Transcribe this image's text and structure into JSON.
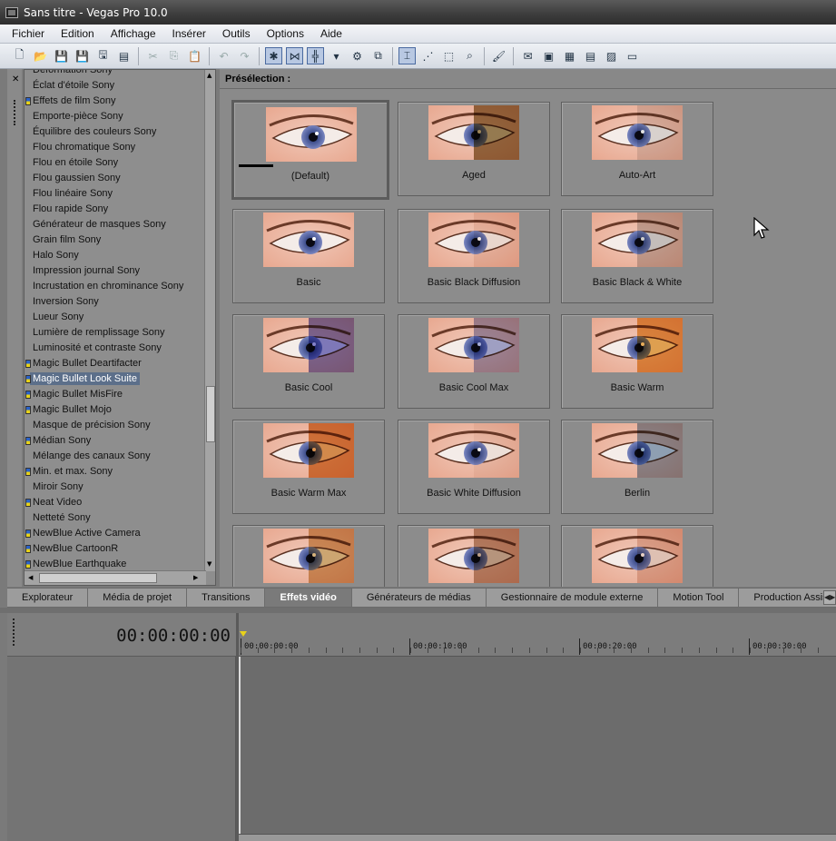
{
  "window": {
    "title": "Sans titre - Vegas Pro 10.0"
  },
  "menu": [
    "Fichier",
    "Edition",
    "Affichage",
    "Insérer",
    "Outils",
    "Options",
    "Aide"
  ],
  "toolbar": [
    {
      "icon": "new-file-icon",
      "glyph": "🗋"
    },
    {
      "icon": "open-icon",
      "glyph": "📂"
    },
    {
      "icon": "save-icon",
      "glyph": "💾"
    },
    {
      "icon": "save-as-icon",
      "glyph": "💾"
    },
    {
      "icon": "render-icon",
      "glyph": "🖫"
    },
    {
      "icon": "properties-icon",
      "glyph": "▤"
    },
    {
      "sep": true
    },
    {
      "icon": "cut-icon",
      "glyph": "✂",
      "disabled": true
    },
    {
      "icon": "copy-icon",
      "glyph": "⎘",
      "disabled": true
    },
    {
      "icon": "paste-icon",
      "glyph": "📋",
      "disabled": true
    },
    {
      "sep": true
    },
    {
      "icon": "undo-icon",
      "glyph": "↶",
      "disabled": true
    },
    {
      "icon": "redo-icon",
      "glyph": "↷",
      "disabled": true
    },
    {
      "sep": true
    },
    {
      "icon": "snapping-icon",
      "glyph": "✱",
      "on": true
    },
    {
      "icon": "auto-crossfade-icon",
      "glyph": "⋈",
      "on": true
    },
    {
      "icon": "auto-ripple-icon",
      "glyph": "╬",
      "on": true
    },
    {
      "icon": "ripple-dropdown-icon",
      "glyph": "▾"
    },
    {
      "icon": "lock-envelopes-icon",
      "glyph": "⚙"
    },
    {
      "icon": "ignore-grouping-icon",
      "glyph": "⧉"
    },
    {
      "sep": true
    },
    {
      "icon": "normal-edit-tool-icon",
      "glyph": "⌶",
      "on": true
    },
    {
      "icon": "envelope-edit-tool-icon",
      "glyph": "⋰"
    },
    {
      "icon": "selection-edit-tool-icon",
      "glyph": "⬚"
    },
    {
      "icon": "zoom-edit-tool-icon",
      "glyph": "⌕"
    },
    {
      "sep": true
    },
    {
      "icon": "paint-icon",
      "glyph": "🖌"
    },
    {
      "sep": true
    },
    {
      "icon": "online-help-icon",
      "glyph": "✉"
    },
    {
      "icon": "what-is-this-icon",
      "glyph": "▣"
    },
    {
      "icon": "media-icon",
      "glyph": "▦"
    },
    {
      "icon": "mixer-icon",
      "glyph": "▤"
    },
    {
      "icon": "preview-icon",
      "glyph": "▨"
    },
    {
      "icon": "video-icon",
      "glyph": "▭"
    }
  ],
  "effects_list": {
    "items": [
      {
        "label": "Déformation Sony"
      },
      {
        "label": "Éclat d'étoile Sony"
      },
      {
        "label": "Effets de film Sony",
        "plugin": true
      },
      {
        "label": "Emporte-pièce Sony"
      },
      {
        "label": "Équilibre des couleurs Sony"
      },
      {
        "label": "Flou chromatique Sony"
      },
      {
        "label": "Flou en étoile Sony"
      },
      {
        "label": "Flou gaussien Sony"
      },
      {
        "label": "Flou linéaire Sony"
      },
      {
        "label": "Flou rapide Sony"
      },
      {
        "label": "Générateur de masques Sony"
      },
      {
        "label": "Grain film Sony"
      },
      {
        "label": "Halo Sony"
      },
      {
        "label": "Impression journal Sony"
      },
      {
        "label": "Incrustation en chrominance Sony"
      },
      {
        "label": "Inversion Sony"
      },
      {
        "label": "Lueur Sony"
      },
      {
        "label": "Lumière de remplissage Sony"
      },
      {
        "label": "Luminosité et contraste Sony"
      },
      {
        "label": "Magic Bullet Deartifacter",
        "plugin": true
      },
      {
        "label": "Magic Bullet Look Suite",
        "plugin": true,
        "selected": true
      },
      {
        "label": "Magic Bullet MisFire",
        "plugin": true
      },
      {
        "label": "Magic Bullet Mojo",
        "plugin": true
      },
      {
        "label": "Masque de précision Sony"
      },
      {
        "label": "Médian Sony",
        "plugin": true
      },
      {
        "label": "Mélange des canaux Sony"
      },
      {
        "label": "Min. et max. Sony",
        "plugin": true
      },
      {
        "label": "Miroir Sony"
      },
      {
        "label": "Neat Video",
        "plugin": true
      },
      {
        "label": "Netteté Sony"
      },
      {
        "label": "NewBlue Active Camera",
        "plugin": true
      },
      {
        "label": "NewBlue CartoonR",
        "plugin": true
      },
      {
        "label": "NewBlue Earthquake",
        "plugin": true
      }
    ]
  },
  "presets": {
    "header": "Présélection :",
    "items": [
      {
        "name": "(Default)",
        "tint": "",
        "selected": true
      },
      {
        "name": "Aged",
        "tint": "#7a5a20"
      },
      {
        "name": "Auto-Art",
        "tint": "#d8d8d8"
      },
      {
        "name": "Basic",
        "tint": ""
      },
      {
        "name": "Basic Black Diffusion",
        "tint": "#f0e0d8"
      },
      {
        "name": "Basic Black & White",
        "tint": "#bcbcbc"
      },
      {
        "name": "Basic Cool",
        "tint": "#5a58b8"
      },
      {
        "name": "Basic Cool Max",
        "tint": "#8890c8"
      },
      {
        "name": "Basic Warm",
        "tint": "#e09020"
      },
      {
        "name": "Basic Warm Max",
        "tint": "#d07018"
      },
      {
        "name": "Basic White Diffusion",
        "tint": "#f4ece8"
      },
      {
        "name": "Berlin",
        "tint": "#7090b0"
      },
      {
        "name": "",
        "tint": "#c89850"
      },
      {
        "name": "",
        "tint": "#a88060"
      },
      {
        "name": "",
        "tint": "#e0c0b0"
      }
    ]
  },
  "tabs": [
    {
      "label": "Explorateur"
    },
    {
      "label": "Média de projet"
    },
    {
      "label": "Transitions"
    },
    {
      "label": "Effets vidéo",
      "active": true
    },
    {
      "label": "Générateurs de médias"
    },
    {
      "label": "Gestionnaire de module externe"
    },
    {
      "label": "Motion Tool"
    },
    {
      "label": "Production Assista"
    }
  ],
  "timeline": {
    "timecode": "00:00:00:00",
    "ruler_labels": [
      "00:00:00:00",
      "00:00:10:00",
      "00:00:20:00",
      "00:00:30:00"
    ]
  },
  "colors": {
    "selection": "#5c6f8a",
    "plugin_badge_blue": "#2a62c8",
    "plugin_badge_yellow": "#e8d21a"
  }
}
